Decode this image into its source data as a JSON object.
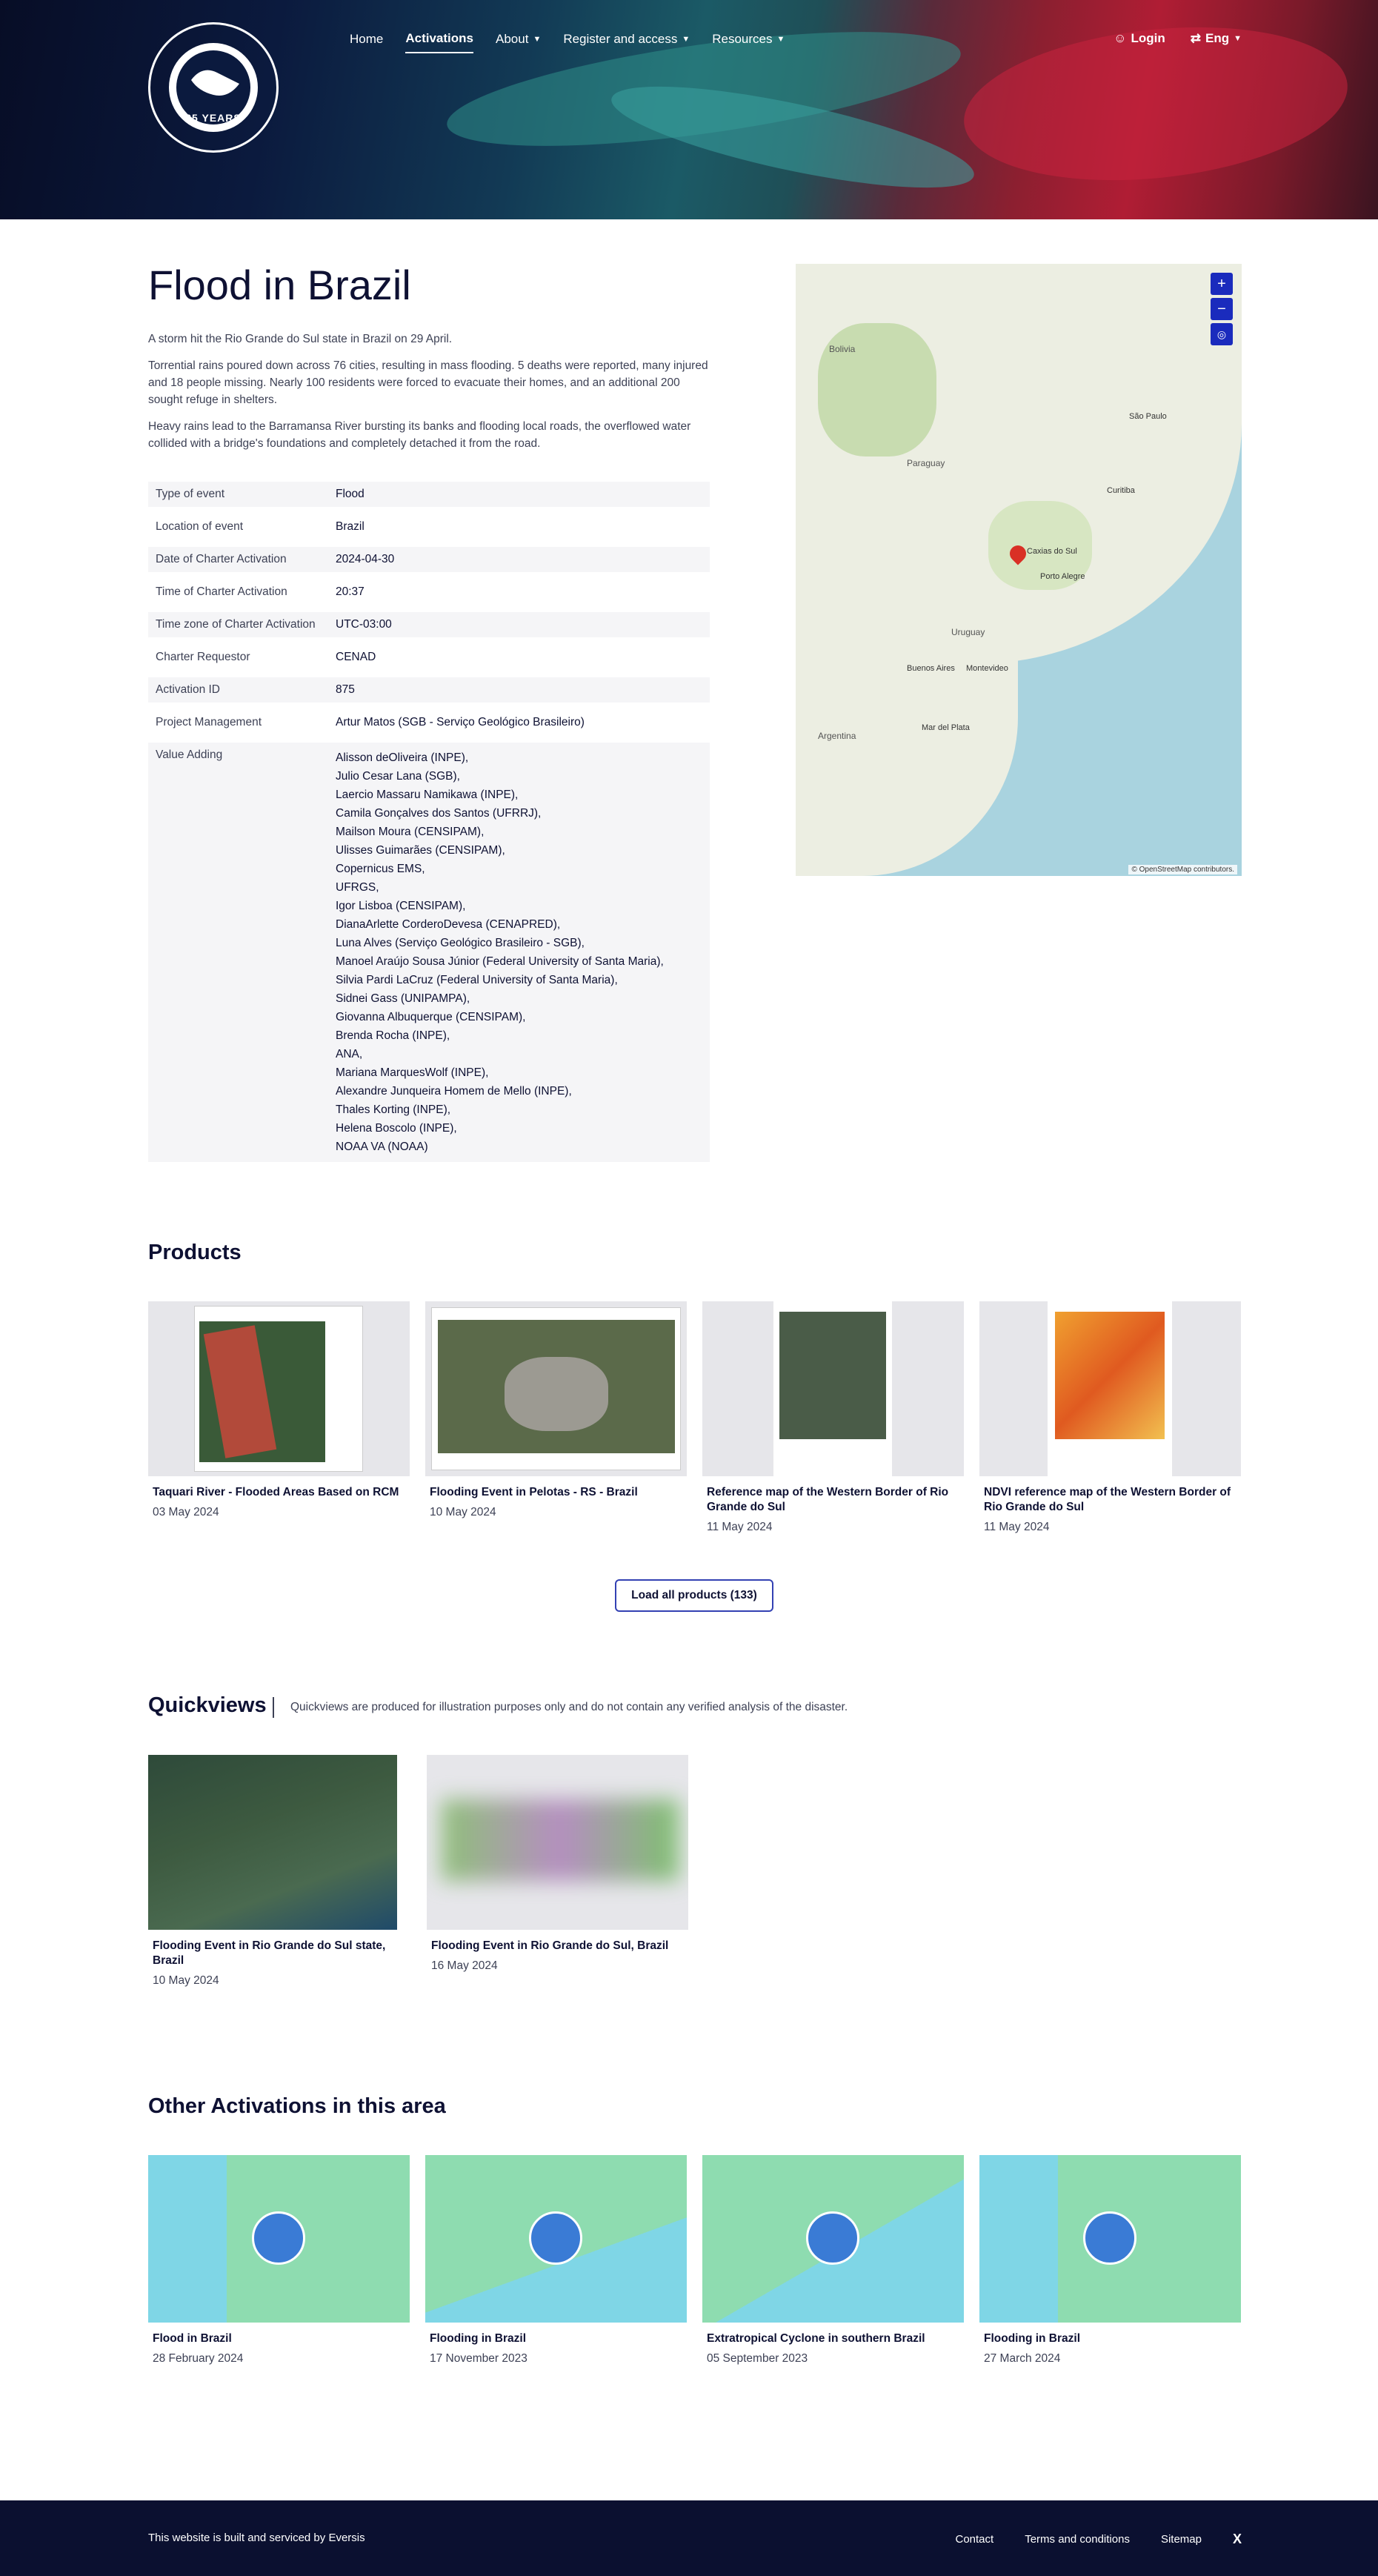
{
  "header": {
    "logo_text": "25 YEARS",
    "nav": [
      {
        "label": "Home",
        "has_dropdown": false
      },
      {
        "label": "Activations",
        "has_dropdown": false,
        "active": true
      },
      {
        "label": "About",
        "has_dropdown": true
      },
      {
        "label": "Register and access",
        "has_dropdown": true
      },
      {
        "label": "Resources",
        "has_dropdown": true
      }
    ],
    "login_label": "Login",
    "language_label": "Eng"
  },
  "page": {
    "title": "Flood in Brazil",
    "intro": [
      "A storm hit the Rio Grande do Sul state in Brazil on 29 April.",
      "Torrential rains poured down across 76 cities, resulting in mass flooding. 5 deaths were reported, many injured and 18 people missing. Nearly 100 residents were forced to evacuate their homes, and an additional 200 sought refuge in shelters.",
      "Heavy rains lead to the Barramansa River bursting its banks and flooding local roads, the overflowed water collided with a bridge's foundations and completely detached it from the road."
    ],
    "details": [
      {
        "key": "Type of event",
        "value": "Flood"
      },
      {
        "key": "Location of event",
        "value": "Brazil"
      },
      {
        "key": "Date of Charter Activation",
        "value": "2024-04-30"
      },
      {
        "key": "Time of Charter Activation",
        "value": "20:37"
      },
      {
        "key": "Time zone of Charter Activation",
        "value": "UTC-03:00"
      },
      {
        "key": "Charter Requestor",
        "value": "CENAD"
      },
      {
        "key": "Activation ID",
        "value": "875"
      },
      {
        "key": "Project Management",
        "value": "Artur Matos (SGB - Serviço Geológico Brasileiro)"
      }
    ],
    "value_adding_key": "Value Adding",
    "value_adding": [
      "Alisson deOliveira (INPE),",
      "Julio Cesar Lana (SGB),",
      "Laercio Massaru Namikawa (INPE),",
      "Camila Gonçalves dos Santos (UFRRJ),",
      "Mailson Moura (CENSIPAM),",
      "Ulisses Guimarães (CENSIPAM),",
      "Copernicus EMS,",
      "UFRGS,",
      "Igor Lisboa (CENSIPAM),",
      "DianaArlette CorderoDevesa (CENAPRED),",
      "Luna Alves (Serviço Geológico Brasileiro - SGB),",
      "Manoel Araújo Sousa Júnior (Federal University of Santa Maria),",
      "Silvia Pardi LaCruz (Federal University of Santa Maria),",
      "Sidnei Gass (UNIPAMPA),",
      "Giovanna Albuquerque (CENSIPAM),",
      "Brenda Rocha (INPE),",
      "ANA,",
      "Mariana MarquesWolf (INPE),",
      "Alexandre Junqueira Homem de Mello (INPE),",
      "Thales Korting (INPE),",
      "Helena Boscolo (INPE),",
      "NOAA VA (NOAA)"
    ]
  },
  "map": {
    "zoom_in": "+",
    "zoom_out": "−",
    "attribution": "© OpenStreetMap contributors.",
    "labels": [
      "Bolivia",
      "Paraguay",
      "Argentina",
      "Uruguay",
      "Porto Alegre",
      "Caxias do Sul",
      "Buenos Aires",
      "Montevideo",
      "Mar del Plata",
      "Curitiba",
      "São Paulo"
    ]
  },
  "products": {
    "title": "Products",
    "items": [
      {
        "title": "Taquari River - Flooded Areas Based on RCM",
        "date": "03 May 2024"
      },
      {
        "title": "Flooding Event in Pelotas - RS - Brazil",
        "date": "10 May 2024"
      },
      {
        "title": "Reference map of the Western Border of Rio Grande do Sul",
        "date": "11 May 2024"
      },
      {
        "title": "NDVI reference map of the Western Border of Rio Grande do Sul",
        "date": "11 May 2024"
      }
    ],
    "load_all_label": "Load all products (133)"
  },
  "quickviews": {
    "title": "Quickviews",
    "note": "Quickviews are produced for illustration purposes only and do not contain any verified analysis of the disaster.",
    "items": [
      {
        "title": "Flooding Event in Rio Grande do Sul state, Brazil",
        "date": "10 May 2024"
      },
      {
        "title": "Flooding Event in Rio Grande do Sul, Brazil",
        "date": "16 May 2024"
      }
    ]
  },
  "other": {
    "title": "Other Activations in this area",
    "items": [
      {
        "title": "Flood in Brazil",
        "date": "28 February 2024"
      },
      {
        "title": "Flooding in Brazil",
        "date": "17 November 2023"
      },
      {
        "title": "Extratropical Cyclone in southern Brazil",
        "date": "05 September 2023"
      },
      {
        "title": "Flooding in Brazil",
        "date": "27 March 2024"
      }
    ]
  },
  "footer": {
    "built_by": "This website is built and serviced by Eversis",
    "links": [
      "Contact",
      "Terms and conditions",
      "Sitemap"
    ],
    "social": "X"
  }
}
